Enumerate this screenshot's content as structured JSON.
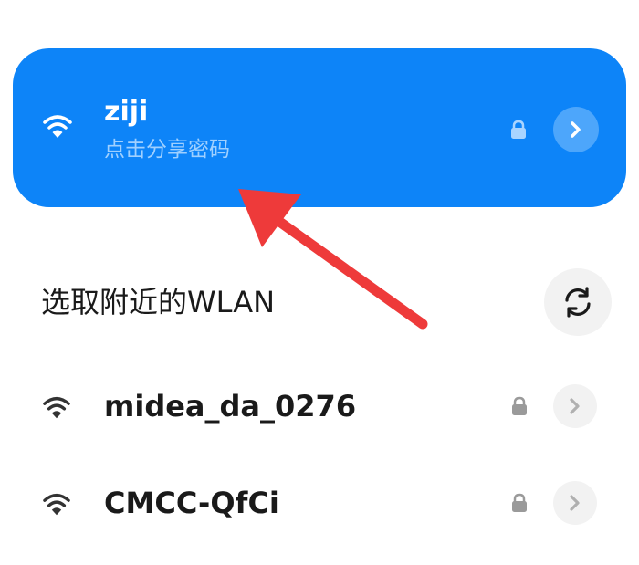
{
  "connected_network": {
    "ssid": "ziji",
    "subtitle": "点击分享密码",
    "secured": true
  },
  "section_title": "选取附近的WLAN",
  "networks": [
    {
      "ssid": "midea_da_0276",
      "secured": true
    },
    {
      "ssid": "CMCC-QfCi",
      "secured": true
    }
  ],
  "colors": {
    "accent": "#0d84f8",
    "annotation_arrow": "#ee3a3a"
  },
  "icons": {
    "wifi": "wifi-icon",
    "lock": "lock-icon",
    "detail": "chevron-right-icon",
    "refresh": "refresh-icon"
  }
}
